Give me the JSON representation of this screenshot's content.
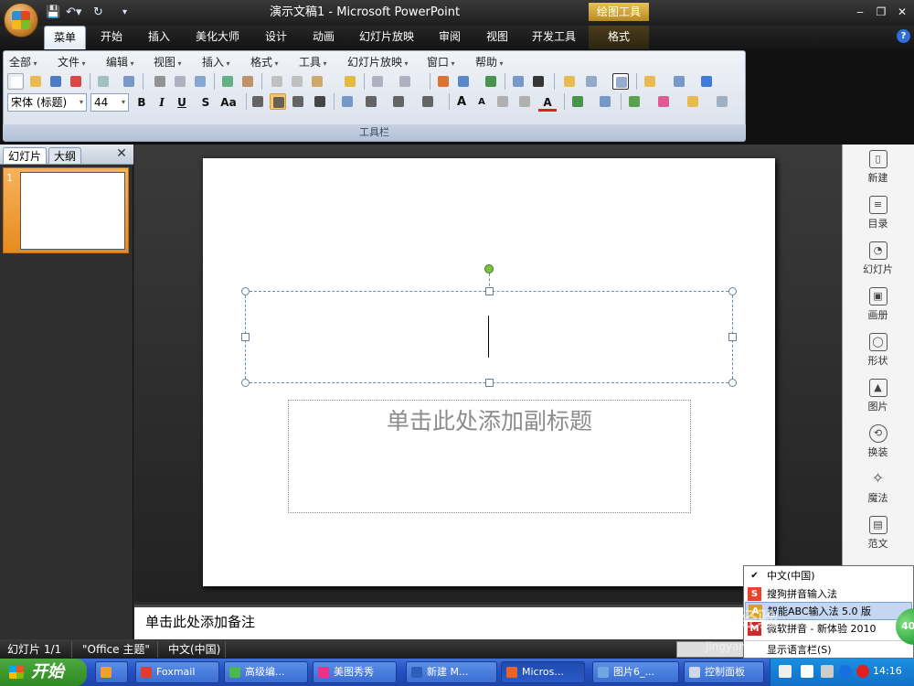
{
  "window": {
    "title": "演示文稿1 - Microsoft PowerPoint",
    "context_tools": "绘图工具",
    "minimize": "‒",
    "restore": "❐",
    "close": "✕"
  },
  "qat": {
    "save_icon": "save-icon",
    "undo_icon": "undo-icon",
    "redo_icon": "redo-icon"
  },
  "tabs": [
    {
      "label": "菜单",
      "active": true
    },
    {
      "label": "开始"
    },
    {
      "label": "插入"
    },
    {
      "label": "美化大师"
    },
    {
      "label": "设计"
    },
    {
      "label": "动画"
    },
    {
      "label": "幻灯片放映"
    },
    {
      "label": "审阅"
    },
    {
      "label": "视图"
    },
    {
      "label": "开发工具"
    },
    {
      "label": "格式"
    }
  ],
  "help_icon": "?",
  "ribbon": {
    "menus": [
      "全部",
      "文件",
      "编辑",
      "视图",
      "插入",
      "格式",
      "工具",
      "幻灯片放映",
      "窗口",
      "帮助"
    ],
    "font_name": "宋体 (标题)",
    "font_size": "44",
    "bold": "B",
    "italic": "I",
    "underline": "U",
    "shadow": "S",
    "change_case": "Aa",
    "grow_font": "A",
    "shrink_font": "A",
    "font_color": "A",
    "textbox_icon": "A",
    "group_label": "工具栏"
  },
  "pane": {
    "tab_slides": "幻灯片",
    "tab_outline": "大纲",
    "close": "✕",
    "slide_number": "1"
  },
  "slide": {
    "subtitle_placeholder": "单击此处添加副标题"
  },
  "notes": {
    "placeholder": "单击此处添加备注"
  },
  "right_panel": [
    {
      "icon": "new-page-icon",
      "glyph": "▯",
      "label": "新建"
    },
    {
      "icon": "list-icon",
      "glyph": "≡",
      "label": "目录"
    },
    {
      "icon": "slide-icon",
      "glyph": "◔",
      "label": "幻灯片"
    },
    {
      "icon": "album-icon",
      "glyph": "▣",
      "label": "画册"
    },
    {
      "icon": "shape-icon",
      "glyph": "◯",
      "label": "形状"
    },
    {
      "icon": "picture-icon",
      "glyph": "▲",
      "label": "图片"
    },
    {
      "icon": "swap-icon",
      "glyph": "⟲",
      "label": "换装"
    },
    {
      "icon": "magic-wand-icon",
      "glyph": "✧",
      "label": "魔法"
    },
    {
      "icon": "template-icon",
      "glyph": "▤",
      "label": "范文"
    }
  ],
  "status": {
    "slide_count": "幻灯片 1/1",
    "theme": "\"Office 主题\"",
    "language": "中文(中国)"
  },
  "ime_menu": [
    {
      "label": "中文(中国)",
      "checked": true,
      "icon": "✔"
    },
    {
      "label": "搜狗拼音输入法",
      "icon": "S",
      "color": "#e8432d"
    },
    {
      "label": "智能ABC输入法 5.0 版",
      "icon": "A",
      "color": "#d9a21e",
      "highlight": true
    },
    {
      "label": "微软拼音 - 新体验 2010",
      "icon": "M",
      "color": "#d02b2b"
    },
    {
      "label": "显示语言栏(S)",
      "icon": ""
    }
  ],
  "watermark": {
    "main": "Bai 经验",
    "sub": "jingyan"
  },
  "taskbar": {
    "start": "开始",
    "buttons": [
      {
        "label": "Foxmail",
        "color": "#e03c31"
      },
      {
        "label": "高级编...",
        "color": "#4cb84c"
      },
      {
        "label": "美图秀秀",
        "color": "#e8338a"
      },
      {
        "label": "新建 M...",
        "color": "#2b5fb8"
      },
      {
        "label": "Micros...",
        "color": "#e8632b"
      },
      {
        "label": "图片6_...",
        "color": "#6fa7e0"
      },
      {
        "label": "控制面板",
        "color": "#cfd8e8"
      }
    ],
    "clock": "14:16"
  },
  "colors": {
    "accent": "#f8c56b",
    "taskbar": "#2552c4",
    "start": "#3a9a2c",
    "handle": "#7cc242"
  }
}
